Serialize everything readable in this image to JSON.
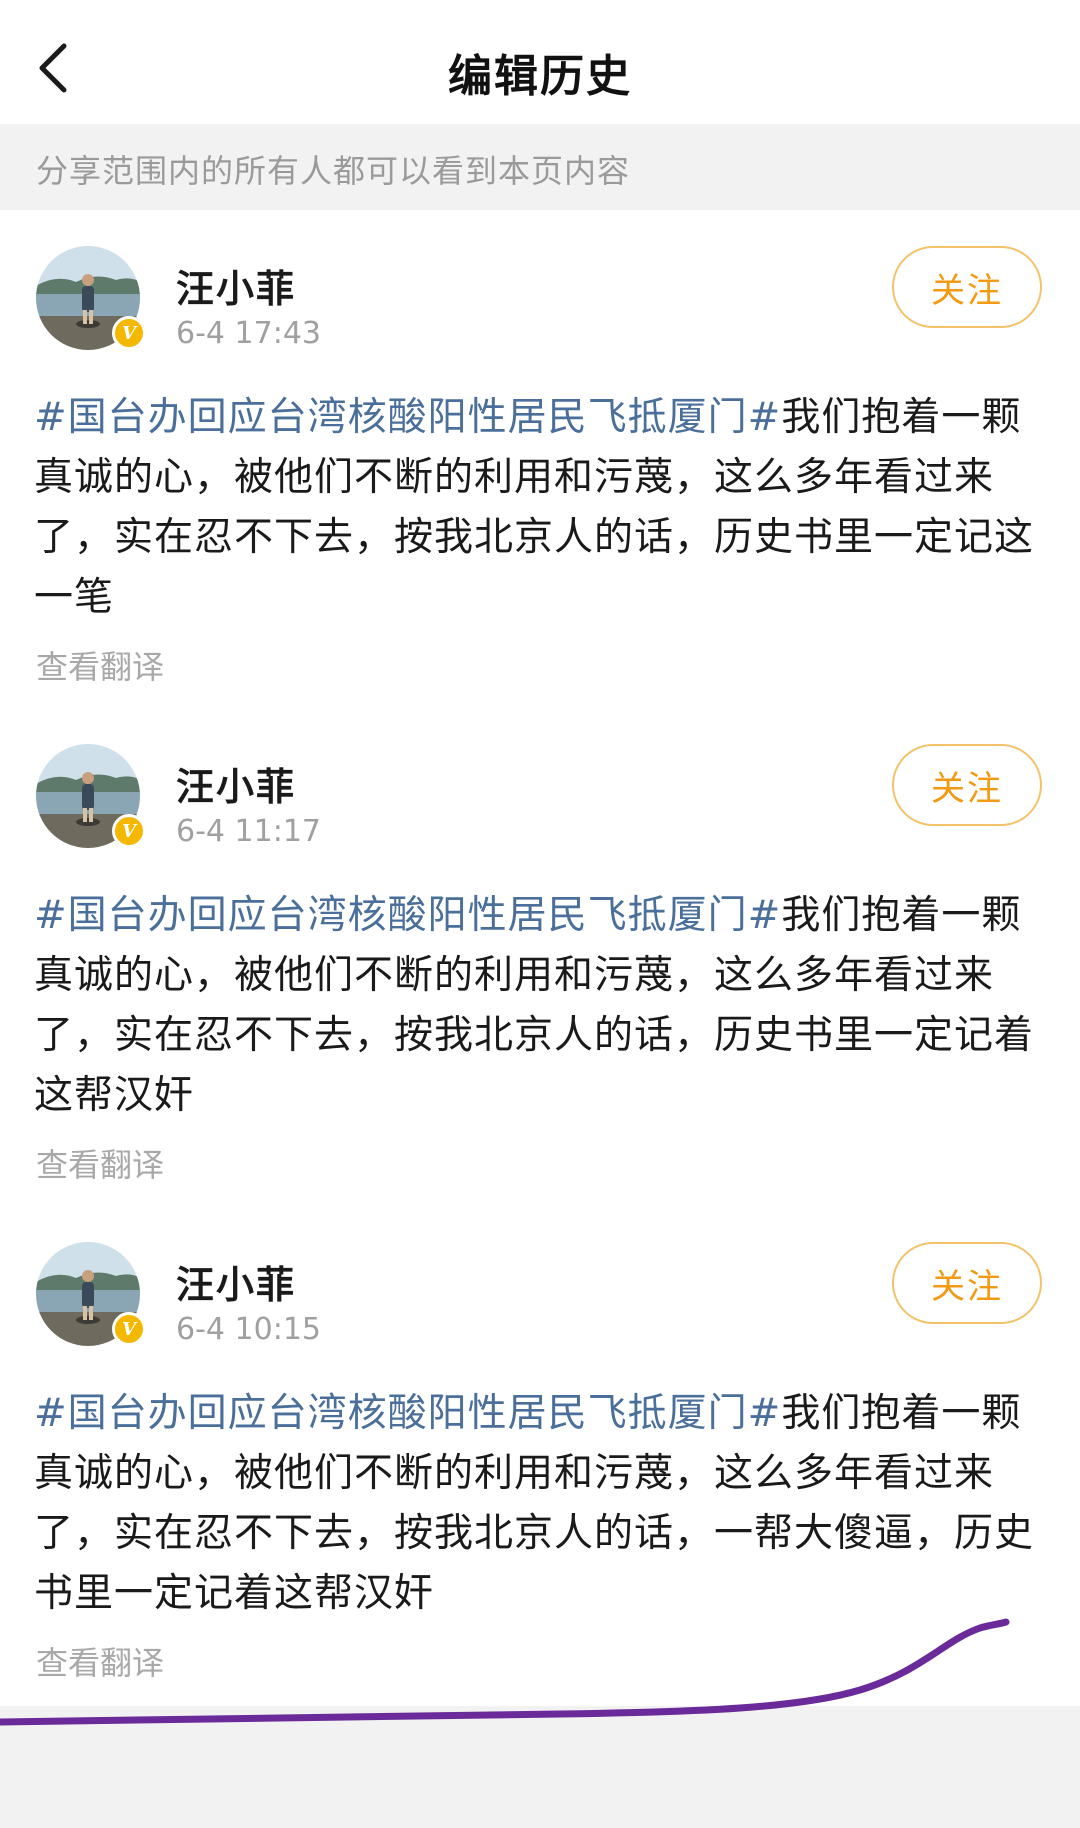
{
  "nav": {
    "title": "编辑历史"
  },
  "notice": {
    "text": "分享范围内的所有人都可以看到本页内容"
  },
  "posts": [
    {
      "username": "汪小菲",
      "timestamp": "6-4 17:43",
      "follow_label": "关注",
      "hashtag": "#国台办回应台湾核酸阳性居民飞抵厦门#",
      "text": "我们抱着一颗真诚的心，被他们不断的利用和污蔑，这么多年看过来了，实在忍不下去，按我北京人的话，历史书里一定记这一笔",
      "translate_label": "查看翻译"
    },
    {
      "username": "汪小菲",
      "timestamp": "6-4 11:17",
      "follow_label": "关注",
      "hashtag": "#国台办回应台湾核酸阳性居民飞抵厦门#",
      "text": "我们抱着一颗真诚的心，被他们不断的利用和污蔑，这么多年看过来了，实在忍不下去，按我北京人的话，历史书里一定记着这帮汉奸",
      "translate_label": "查看翻译"
    },
    {
      "username": "汪小菲",
      "timestamp": "6-4 10:15",
      "follow_label": "关注",
      "hashtag": "#国台办回应台湾核酸阳性居民飞抵厦门#",
      "text": "我们抱着一颗真诚的心，被他们不断的利用和污蔑，这么多年看过来了，实在忍不下去，按我北京人的话，一帮大傻逼，历史书里一定记着这帮汉奸",
      "translate_label": "查看翻译"
    }
  ],
  "colors": {
    "hashtag": "#4b6f9b",
    "follow": "#f39a12",
    "badge": "#f5b800",
    "annotation": "#6a2a9a"
  },
  "icons": {
    "back": "chevron-left-icon",
    "badge": "verified-v-icon"
  }
}
